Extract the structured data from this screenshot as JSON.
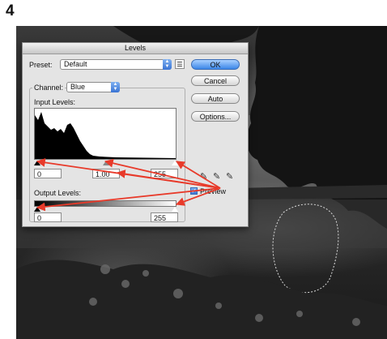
{
  "step_number": "4",
  "dialog": {
    "title": "Levels",
    "preset_label": "Preset:",
    "preset_value": "Default",
    "channel_label": "Channel:",
    "channel_value": "Blue",
    "input_levels_label": "Input Levels:",
    "output_levels_label": "Output Levels:",
    "input_black": "0",
    "input_gamma": "1.00",
    "input_white": "255",
    "output_black": "0",
    "output_white": "255",
    "preview_label": "Preview",
    "preview_checked": true
  },
  "buttons": {
    "ok": "OK",
    "cancel": "Cancel",
    "auto": "Auto",
    "options": "Options..."
  },
  "icons": {
    "preset_menu": "preset-options-icon",
    "eyedroppers": [
      "black-eyedropper-icon",
      "gray-eyedropper-icon",
      "white-eyedropper-icon"
    ],
    "arrows": "red-annotation-arrows"
  },
  "colors": {
    "default_button": "#3b86e8",
    "annotation_arrow": "#e83a2a"
  }
}
